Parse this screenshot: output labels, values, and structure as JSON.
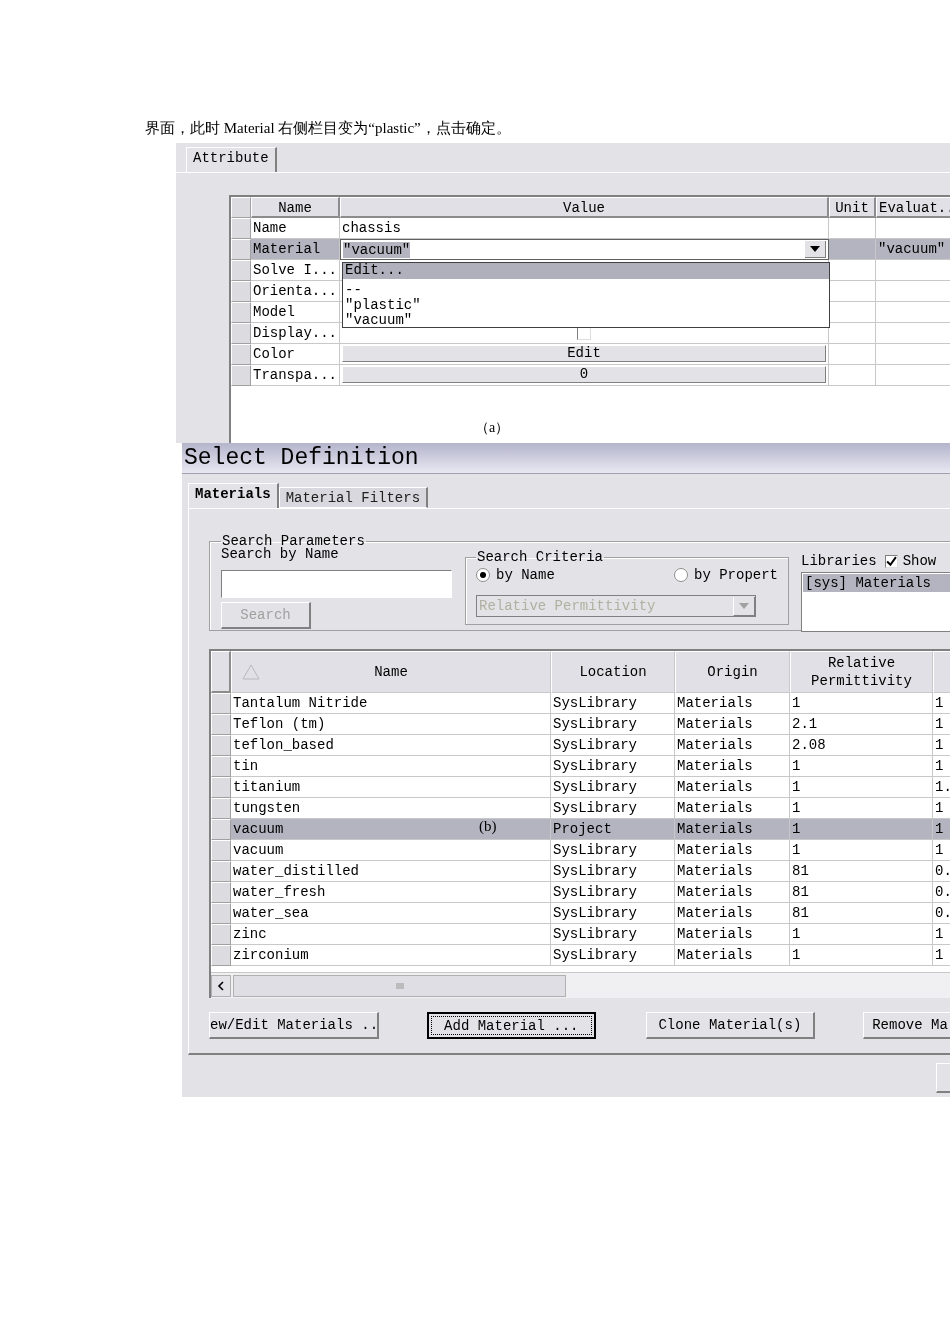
{
  "caption": "界面，此时 Material 右侧栏目变为“plastic”，点击确定。",
  "attribute_panel": {
    "tabs": [
      {
        "label": "Attribute",
        "selected": true
      }
    ],
    "columns": [
      "Name",
      "Value",
      "Unit",
      "Evaluat.."
    ],
    "rows": [
      {
        "name": "Name",
        "kind": "text",
        "value": "chassis",
        "selected": false
      },
      {
        "name": "Material",
        "kind": "dropdown",
        "value": "″vacuum″",
        "evaluated": "″vacuum″",
        "selected": true
      },
      {
        "name": "Solve I...",
        "kind": "text",
        "selected": false
      },
      {
        "name": "Orienta...",
        "kind": "text",
        "selected": false
      },
      {
        "name": "Model",
        "kind": "text",
        "selected": false
      },
      {
        "name": "Display...",
        "kind": "checkbox",
        "checked": false,
        "selected": false
      },
      {
        "name": "Color",
        "kind": "button",
        "value": "Edit",
        "selected": false
      },
      {
        "name": "Transpa...",
        "kind": "button",
        "value": "0",
        "selected": false
      }
    ],
    "dropdown_menu": [
      {
        "label": "Edit...",
        "selected": true
      },
      {
        "label": "--",
        "selected": false
      },
      {
        "label": "″plastic″",
        "selected": false
      },
      {
        "label": "″vacuum″",
        "selected": false
      }
    ],
    "figure_label": "（a）"
  },
  "dialog": {
    "title": "Select Definition",
    "tabs": [
      {
        "label": "Materials",
        "selected": true
      },
      {
        "label": "Material Filters",
        "selected": false
      }
    ],
    "search_parameters": {
      "legend": "Search Parameters",
      "label": "Search by Name",
      "search_button": {
        "label": "Search",
        "disabled": true
      }
    },
    "search_criteria": {
      "legend": "Search Criteria",
      "options": [
        {
          "label": "by Name",
          "selected": true
        },
        {
          "label": "by Propert",
          "selected": false
        }
      ],
      "property_dropdown": {
        "value": "Relative Permittivity",
        "disabled": true
      }
    },
    "libraries": {
      "label": "Libraries",
      "show_checkbox": {
        "label": "Show",
        "checked": true
      },
      "items": [
        {
          "label": "[sys] Materials",
          "selected": true
        }
      ]
    },
    "table": {
      "columns": [
        "Name",
        "Location",
        "Origin",
        "Relative Permittivity"
      ],
      "rows": [
        {
          "name": "Tantalum Nitride",
          "location": "SysLibrary",
          "origin": "Materials",
          "relative_permittivity": "1",
          "column_5": "1",
          "selected": false
        },
        {
          "name": "Teflon (tm)",
          "location": "SysLibrary",
          "origin": "Materials",
          "relative_permittivity": "2.1",
          "column_5": "1",
          "selected": false
        },
        {
          "name": "teflon_based",
          "location": "SysLibrary",
          "origin": "Materials",
          "relative_permittivity": "2.08",
          "column_5": "1",
          "selected": false
        },
        {
          "name": "tin",
          "location": "SysLibrary",
          "origin": "Materials",
          "relative_permittivity": "1",
          "column_5": "1",
          "selected": false
        },
        {
          "name": "titanium",
          "location": "SysLibrary",
          "origin": "Materials",
          "relative_permittivity": "1",
          "column_5": "1.",
          "selected": false
        },
        {
          "name": "tungsten",
          "location": "SysLibrary",
          "origin": "Materials",
          "relative_permittivity": "1",
          "column_5": "1",
          "selected": false
        },
        {
          "name": "vacuum",
          "location": "Project",
          "origin": "Materials",
          "relative_permittivity": "1",
          "column_5": "1",
          "selected": true
        },
        {
          "name": "vacuum",
          "location": "SysLibrary",
          "origin": "Materials",
          "relative_permittivity": "1",
          "column_5": "1",
          "selected": false
        },
        {
          "name": "water_distilled",
          "location": "SysLibrary",
          "origin": "Materials",
          "relative_permittivity": "81",
          "column_5": "0.",
          "selected": false
        },
        {
          "name": "water_fresh",
          "location": "SysLibrary",
          "origin": "Materials",
          "relative_permittivity": "81",
          "column_5": "0.",
          "selected": false
        },
        {
          "name": "water_sea",
          "location": "SysLibrary",
          "origin": "Materials",
          "relative_permittivity": "81",
          "column_5": "0.",
          "selected": false
        },
        {
          "name": "zinc",
          "location": "SysLibrary",
          "origin": "Materials",
          "relative_permittivity": "1",
          "column_5": "1",
          "selected": false
        },
        {
          "name": "zirconium",
          "location": "SysLibrary",
          "origin": "Materials",
          "relative_permittivity": "1",
          "column_5": "1",
          "selected": false
        }
      ]
    },
    "buttons": [
      {
        "label": "ew/Edit Materials ..",
        "default": false
      },
      {
        "label": "Add Material ...",
        "default": true
      },
      {
        "label": "Clone Material(s)",
        "default": false
      },
      {
        "label": "Remove Ma",
        "default": false
      }
    ],
    "figure_label": "(b)"
  }
}
